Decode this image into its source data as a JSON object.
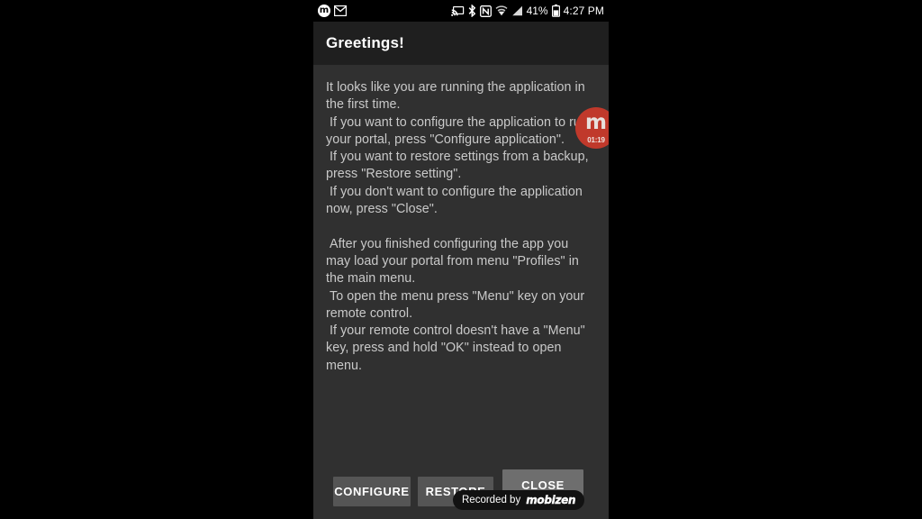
{
  "status_bar": {
    "left_icons": [
      {
        "name": "mobizen-notification-icon",
        "glyph": "m"
      },
      {
        "name": "email-icon",
        "glyph": "email"
      }
    ],
    "right_icons": [
      {
        "name": "screen-cast-icon",
        "glyph": "cast"
      },
      {
        "name": "bluetooth-icon",
        "glyph": "bluetooth"
      },
      {
        "name": "nfc-icon",
        "glyph": "nfc"
      },
      {
        "name": "wifi-icon",
        "glyph": "wifi"
      },
      {
        "name": "cellular-signal-icon",
        "glyph": "signal"
      }
    ],
    "battery_percent": "41%",
    "battery_icon": "battery-icon",
    "clock": "4:27 PM"
  },
  "dialog": {
    "title": "Greetings!",
    "message": "It looks like you are running the application in the first time.\n If you want to configure the application to run your portal, press \"Configure application\".\n If you want to restore settings from a backup, press \"Restore setting\".\n If you don't want to configure the application now, press \"Close\".\n\n After you finished configuring the app you may load your portal from menu \"Profiles\" in the main menu.\n To open the menu press \"Menu\" key on your remote control.\n If your remote control doesn't have a \"Menu\" key, press and hold \"OK\" instead to open menu.",
    "buttons": {
      "configure": "CONFIGURE",
      "restore": "RESTORE",
      "close": "CLOSE"
    },
    "colors": {
      "titlebar_bg": "#1f1f1f",
      "body_bg": "#303030",
      "button_bg": "#555555",
      "button_highlight_bg": "#6e6e6e",
      "text": "#c9c9c9"
    }
  },
  "recorder_bubble": {
    "logo": "m",
    "elapsed": "01:19",
    "color": "#c0392b"
  },
  "watermark": {
    "prefix": "Recorded by",
    "brand": "mobizen"
  }
}
